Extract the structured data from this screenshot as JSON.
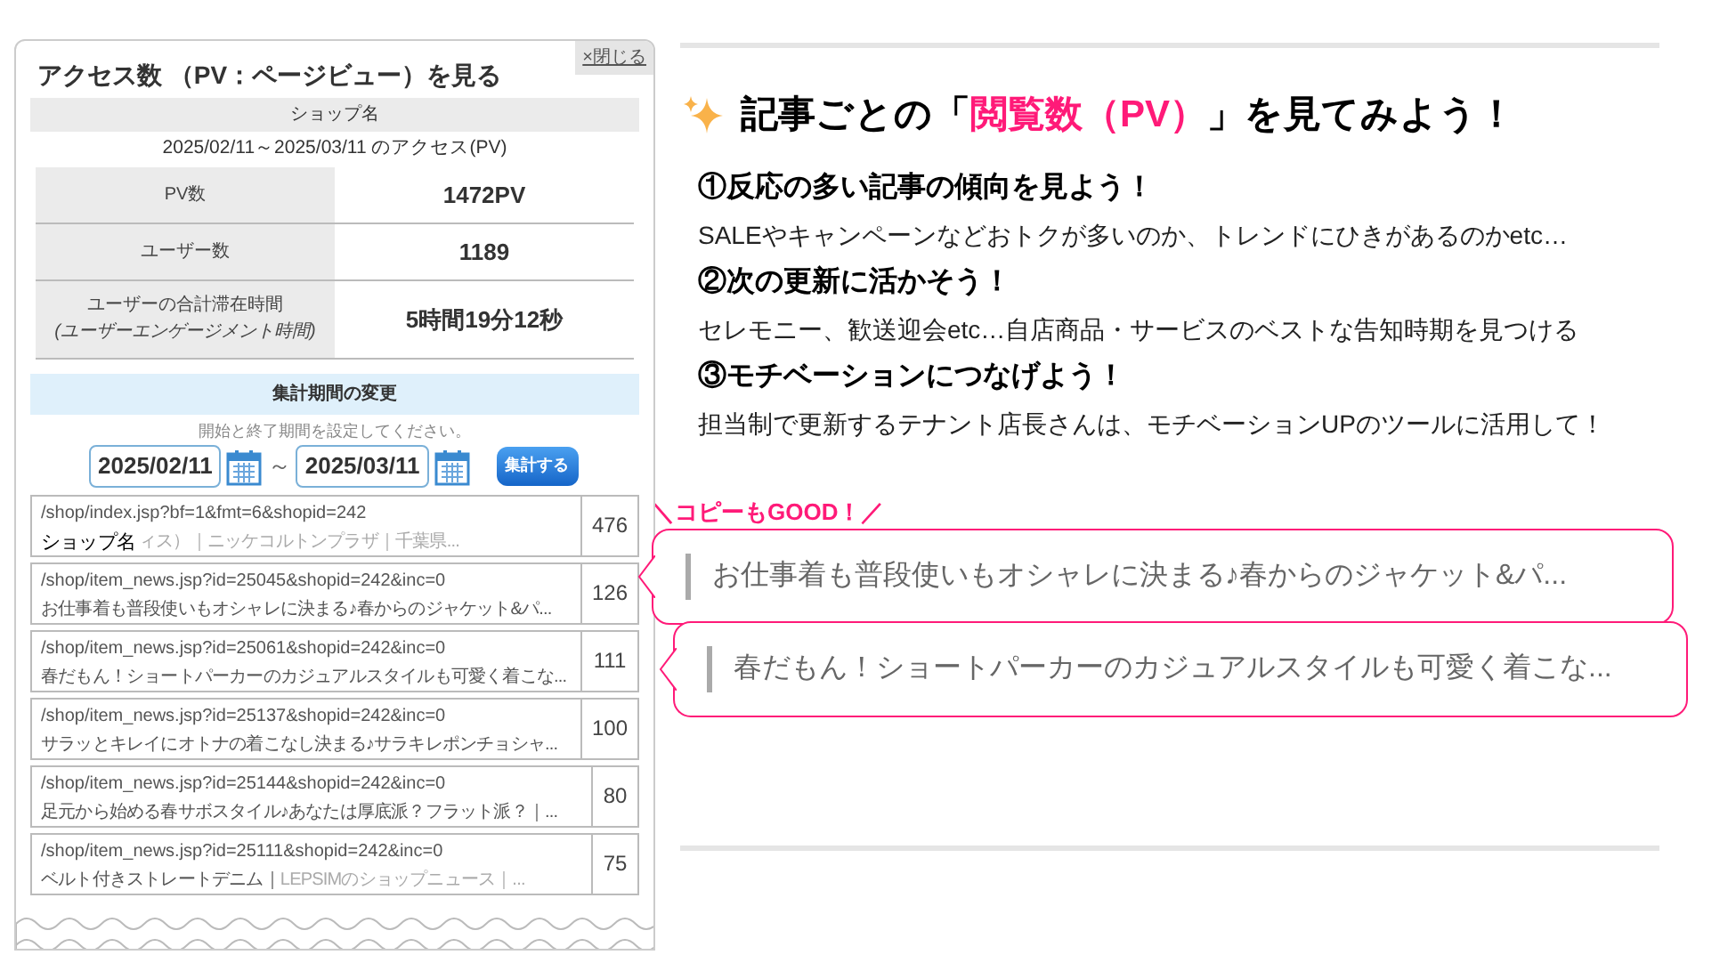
{
  "panel": {
    "title": "アクセス数 （PV：ページビュー）を見る",
    "close_label": "×閉じる",
    "shop_name": "ショップ名",
    "period_caption": "2025/02/11～2025/03/11 のアクセス(PV)",
    "stats": [
      {
        "label": "PV数",
        "value": "1472PV"
      },
      {
        "label": "ユーザー数",
        "value": "1189"
      },
      {
        "label": "ユーザーの合計滞在時間",
        "sublabel": "(ユーザーエンゲージメント時間)",
        "value": "5時間19分12秒"
      }
    ],
    "period_change": {
      "heading": "集計期間の変更",
      "hint": "開始と終了期間を設定してください。",
      "start_date": "2025/02/11",
      "separator": "～",
      "end_date": "2025/03/11",
      "button": "集計する"
    },
    "pages": [
      {
        "url": "/shop/index.jsp?bf=1&fmt=6&shopid=242",
        "label": "ショップ名",
        "faded": "ィス）｜ニッケコルトンプラザ｜千葉県...",
        "count": "476"
      },
      {
        "url": "/shop/item_news.jsp?id=25045&shopid=242&inc=0",
        "title": "お仕事着も普段使いもオシャレに決まる♪春からのジャケット&パ...",
        "count": "126"
      },
      {
        "url": "/shop/item_news.jsp?id=25061&shopid=242&inc=0",
        "title": "春だもん！ショートパーカーのカジュアルスタイルも可愛く着こな...",
        "count": "111"
      },
      {
        "url": "/shop/item_news.jsp?id=25137&shopid=242&inc=0",
        "title": "サラッとキレイにオトナの着こなし決まる♪サラキレポンチョシャ...",
        "count": "100"
      },
      {
        "url": "/shop/item_news.jsp?id=25144&shopid=242&inc=0",
        "title": "足元から始める春サボスタイル♪あなたは厚底派？フラット派？｜...",
        "count": "80"
      },
      {
        "url": "/shop/item_news.jsp?id=25111&shopid=242&inc=0",
        "title": "ベルト付きストレートデニム｜",
        "faded": "LEPSIMのショップニュース｜...",
        "count": "75"
      }
    ]
  },
  "article": {
    "heading_before": "記事ごとの「",
    "heading_highlight": "閲覧数（PV）",
    "heading_after": "」を見てみよう！",
    "sections": [
      {
        "heading": "①反応の多い記事の傾向を見よう！",
        "body": "SALEやキャンペーンなどおトクが多いのか、トレンドにひきがあるのかetc…"
      },
      {
        "heading": "②次の更新に活かそう！",
        "body": "セレモニー、歓送迎会etc…自店商品・サービスのベストな告知時期を見つける"
      },
      {
        "heading": "③モチベーションにつなげよう！",
        "body": "担当制で更新するテナント店長さんは、モチベーションUPのツールに活用して！"
      }
    ],
    "copy_label": "＼コピーもGOOD！／",
    "bubbles": [
      "お仕事着も普段使いもオシャレに決まる♪春からのジャケット&パ...",
      "春だもん！ショートパーカーのカジュアルスタイルも可愛く着こな..."
    ]
  }
}
